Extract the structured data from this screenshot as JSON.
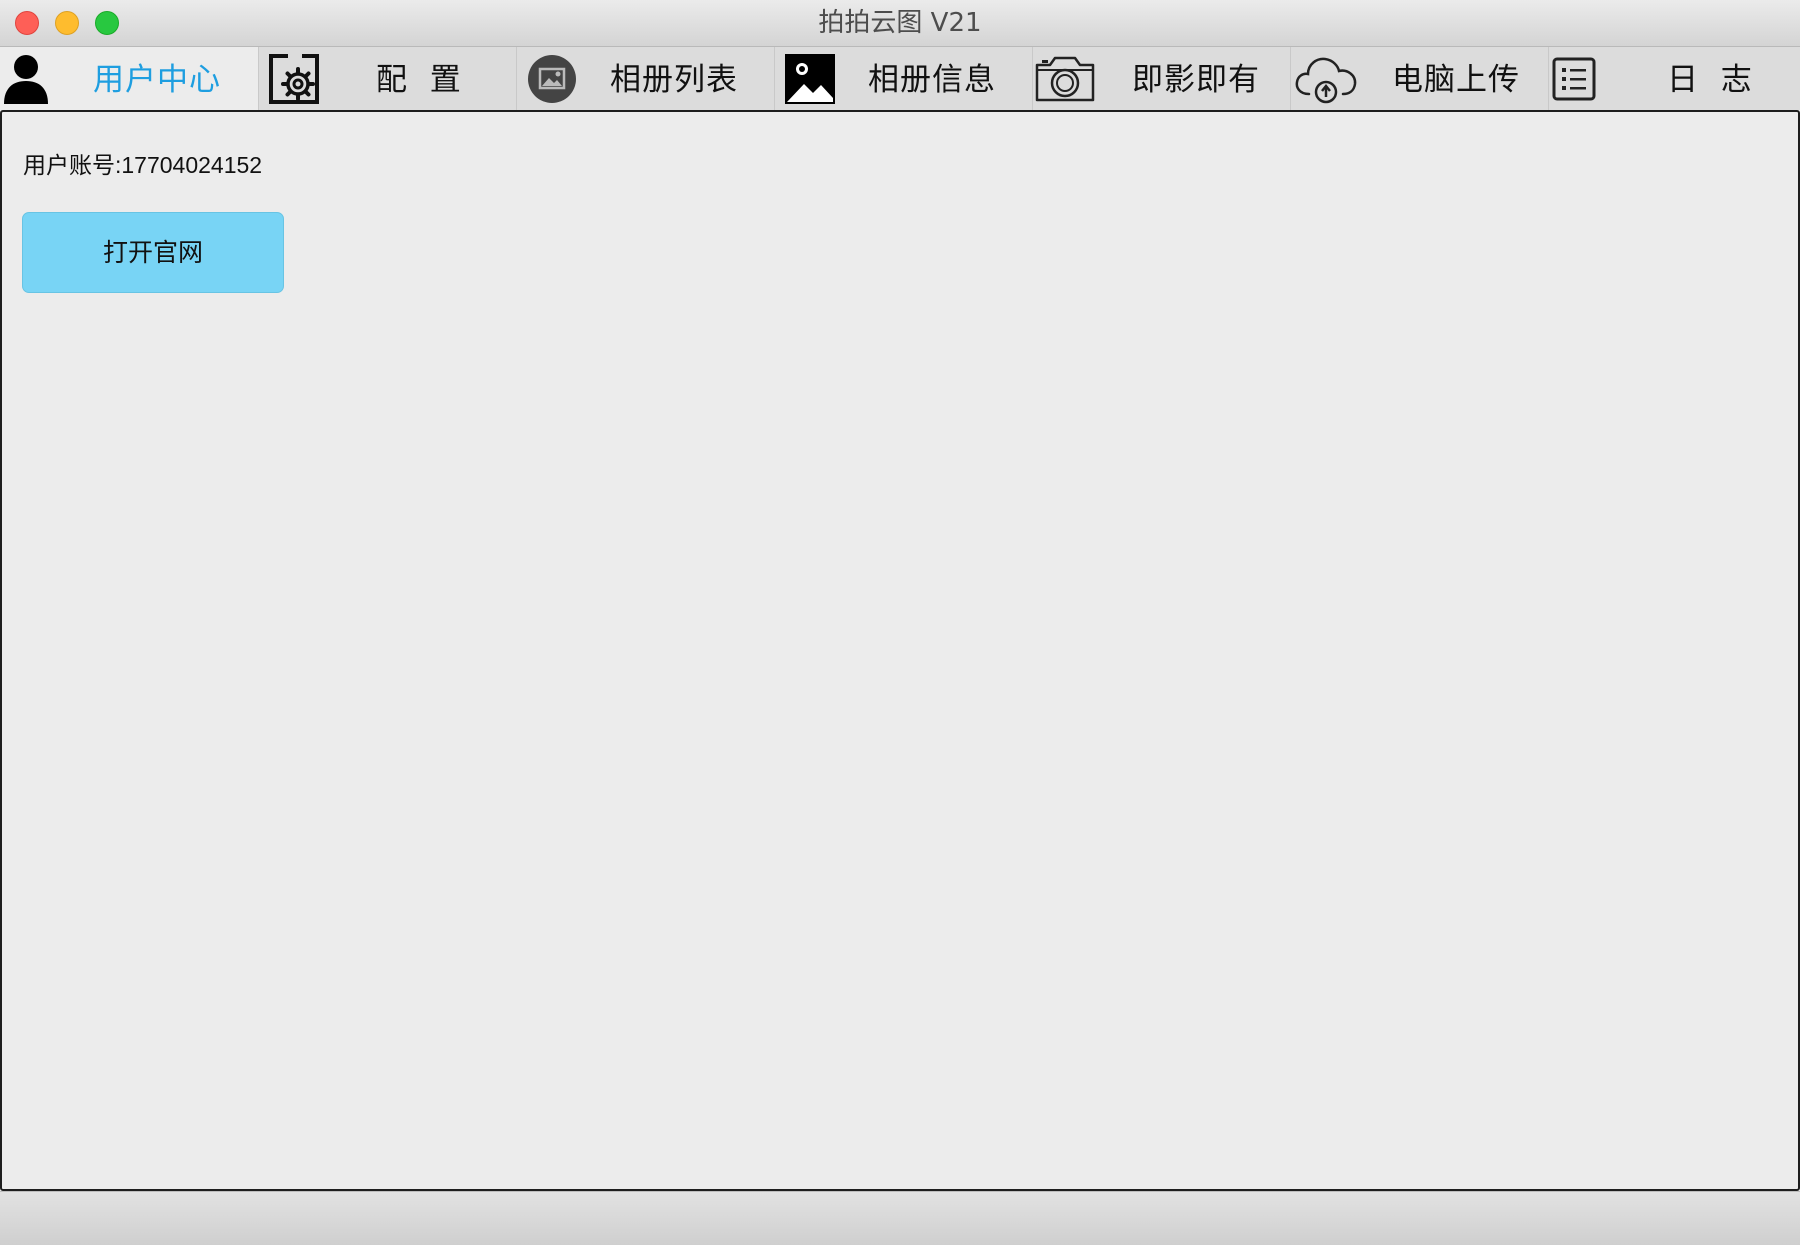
{
  "window": {
    "title": "拍拍云图 V21"
  },
  "tabs": [
    {
      "label": "用户中心",
      "icon": "user-icon",
      "active": true
    },
    {
      "label": "配  置",
      "icon": "gear-icon",
      "active": false
    },
    {
      "label": "相册列表",
      "icon": "album-icon",
      "active": false
    },
    {
      "label": "相册信息",
      "icon": "picture-icon",
      "active": false
    },
    {
      "label": "即影即有",
      "icon": "camera-icon",
      "active": false
    },
    {
      "label": "电脑上传",
      "icon": "cloud-upload-icon",
      "active": false
    },
    {
      "label": "日  志",
      "icon": "list-icon",
      "active": false
    }
  ],
  "user_center": {
    "account_text": "用户账号:17704024152",
    "open_site_label": "打开官网"
  },
  "colors": {
    "active_tab_text": "#1e9ee0",
    "button_bg": "#78d4f5",
    "panel_bg": "#ececec"
  }
}
